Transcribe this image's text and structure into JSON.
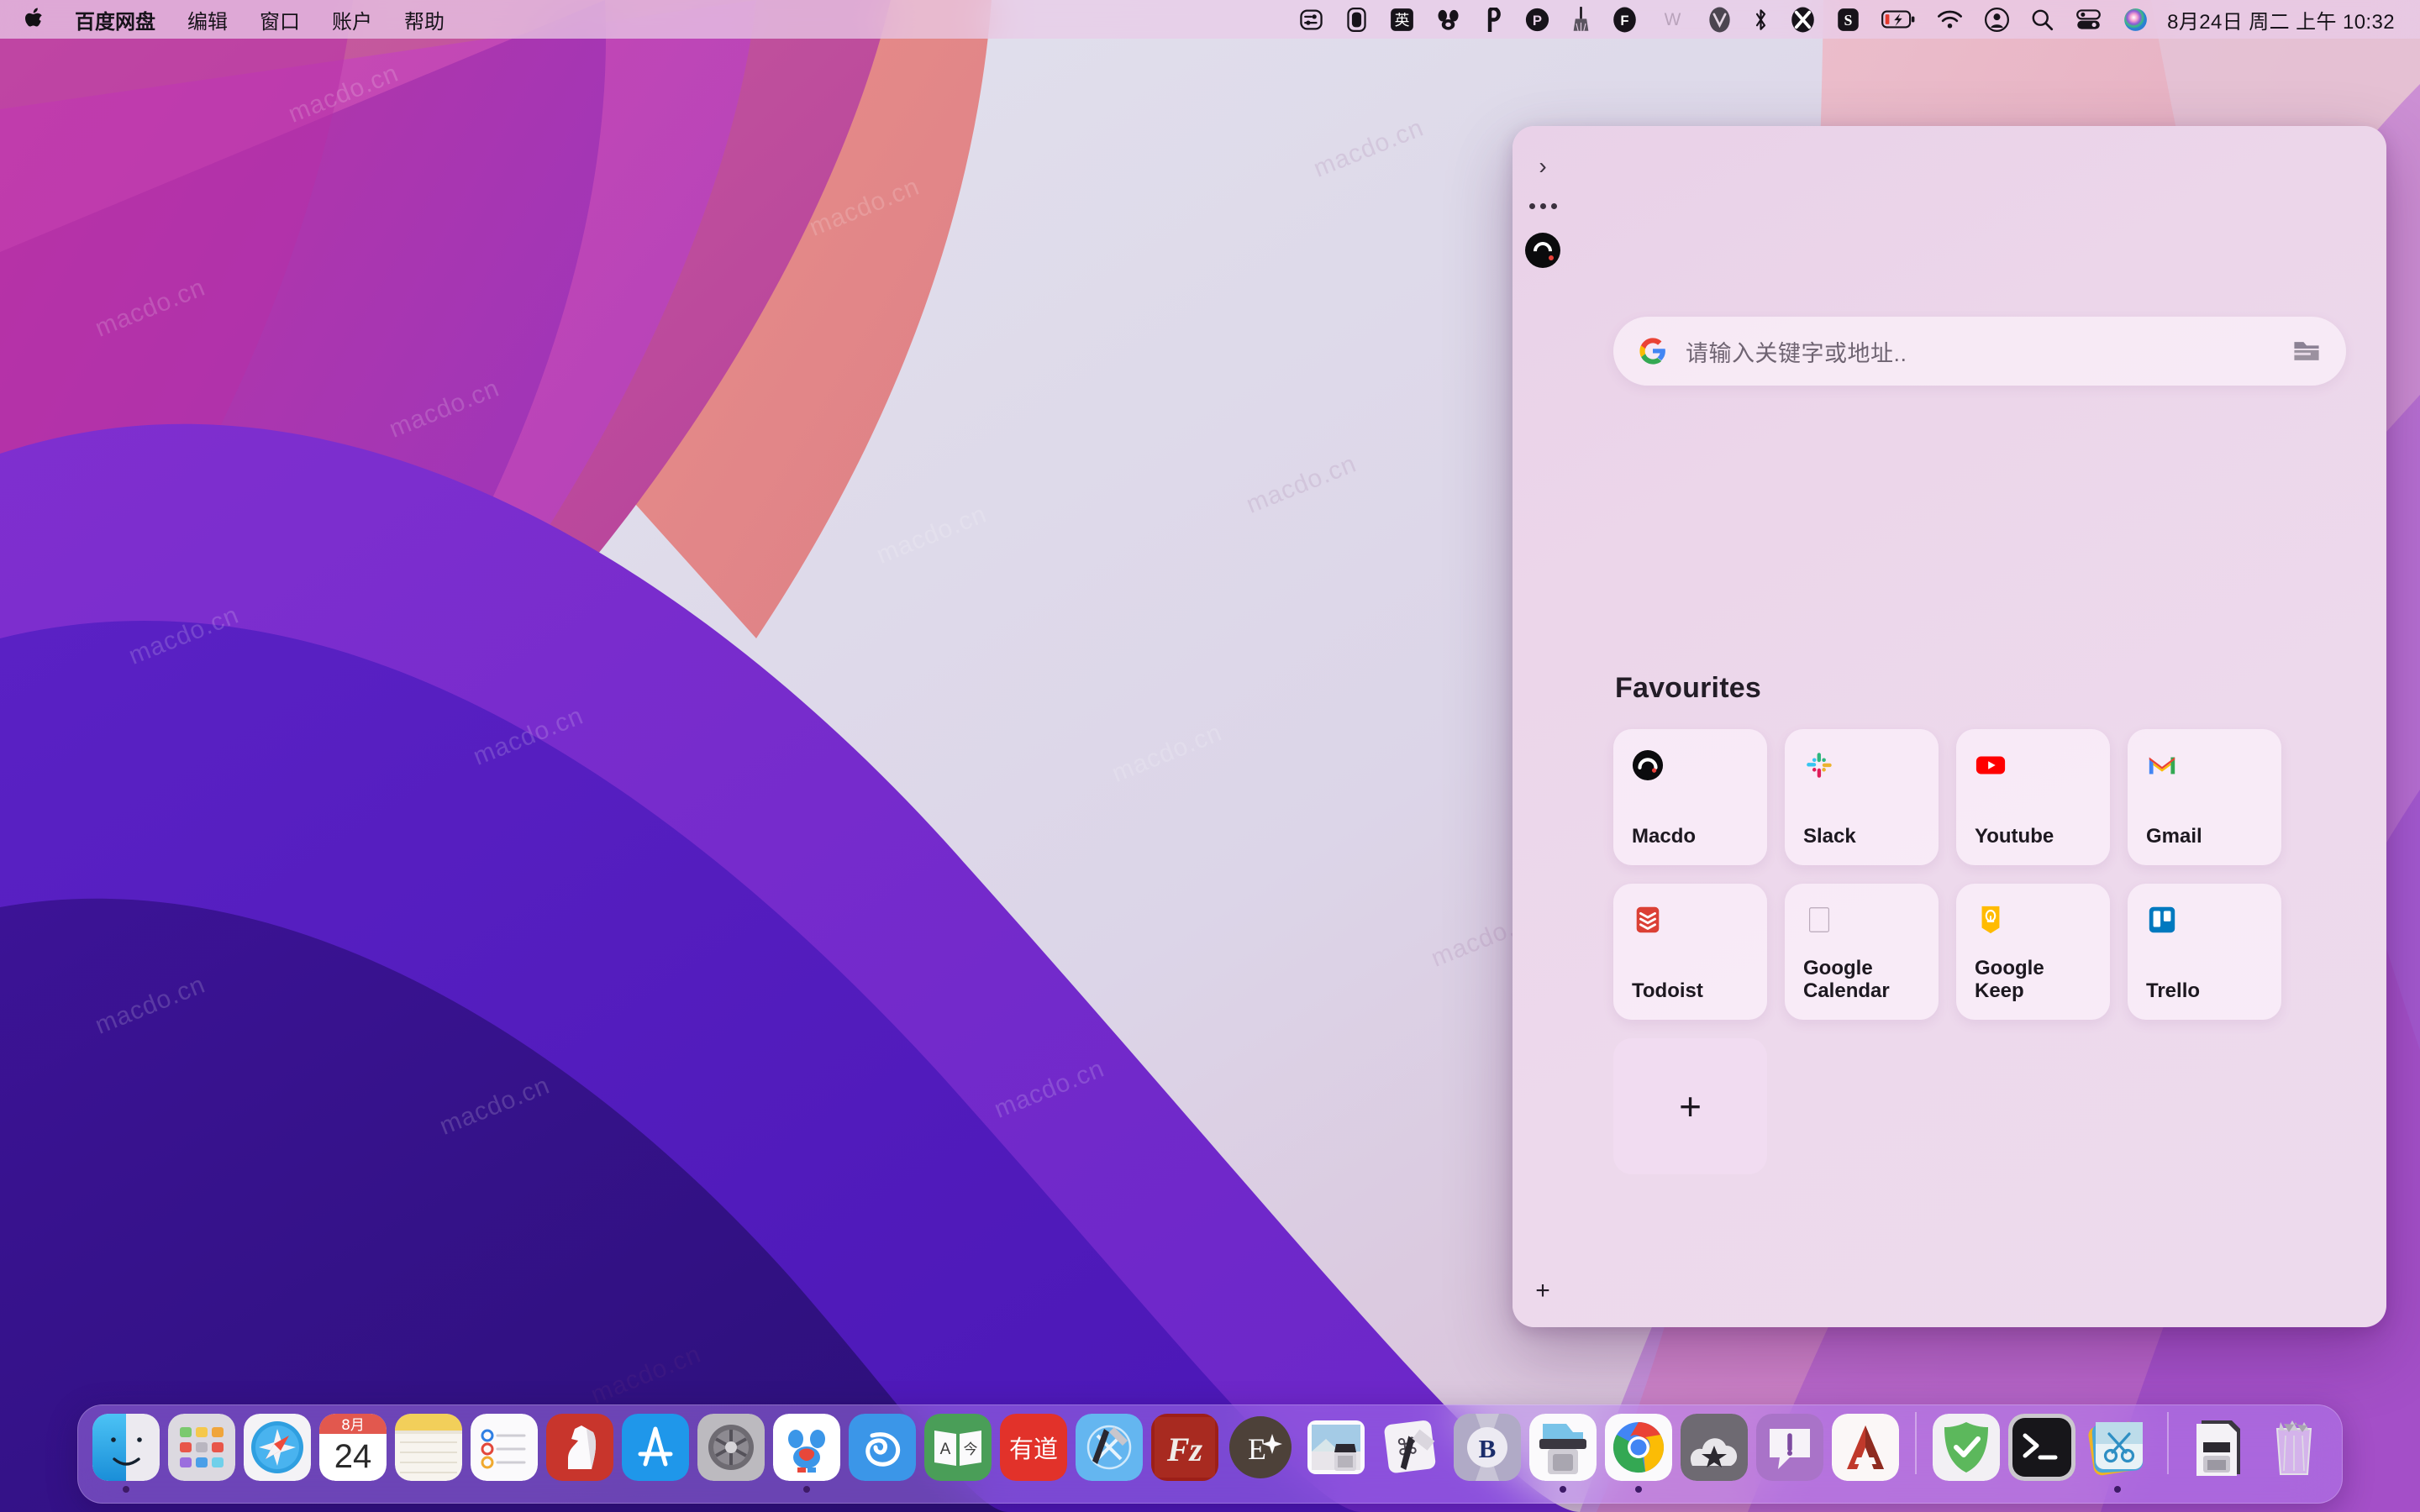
{
  "menubar": {
    "apple_icon": "apple-logo",
    "items": [
      {
        "label": "百度网盘",
        "bold": true
      },
      {
        "label": "编辑",
        "bold": false
      },
      {
        "label": "窗口",
        "bold": false
      },
      {
        "label": "账户",
        "bold": false
      },
      {
        "label": "帮助",
        "bold": false
      }
    ],
    "tray_icons": [
      "shortcuts-icon",
      "battery-widget-icon",
      "input-source-chinese-icon",
      "baidu-netdisk-icon",
      "paste-icon",
      "paypal-p-icon",
      "cleaner-broom-icon",
      "f-app-icon",
      "w-app-icon",
      "v-app-icon",
      "bluetooth-icon",
      "x-app-icon",
      "s-app-icon",
      "battery-charging-icon",
      "wifi-icon",
      "user-account-icon",
      "spotlight-search-icon",
      "control-center-icon",
      "siri-icon"
    ],
    "clock": "8月24日 周二 上午 10:32"
  },
  "panel": {
    "sidebar": {
      "chevron_icon": "chevron-right-icon",
      "more_icon": "more-dots-icon",
      "profile_icon": "macdo-logo-icon",
      "add_icon": "plus-icon"
    },
    "search": {
      "engine_icon": "google-g-icon",
      "placeholder": "请输入关键字或地址..",
      "bookmark_icon": "folder-icon"
    },
    "favourites": {
      "title": "Favourites",
      "tiles": [
        {
          "label": "Macdo",
          "icon": "macdo-icon"
        },
        {
          "label": "Slack",
          "icon": "slack-icon"
        },
        {
          "label": "Youtube",
          "icon": "youtube-icon"
        },
        {
          "label": "Gmail",
          "icon": "gmail-icon"
        },
        {
          "label": "Todoist",
          "icon": "todoist-icon"
        },
        {
          "label": "Google Calendar",
          "icon": "google-calendar-icon"
        },
        {
          "label": "Google Keep",
          "icon": "google-keep-icon"
        },
        {
          "label": "Trello",
          "icon": "trello-icon"
        }
      ],
      "add_label": "+"
    }
  },
  "dock": {
    "items": [
      {
        "name": "Finder",
        "icon": "finder-icon",
        "running": true
      },
      {
        "name": "Launchpad",
        "icon": "launchpad-icon",
        "running": false
      },
      {
        "name": "Safari",
        "icon": "safari-icon",
        "running": false
      },
      {
        "name": "Calendar",
        "icon": "calendar-icon",
        "running": false,
        "month": "8月",
        "day": "24"
      },
      {
        "name": "Notes",
        "icon": "notes-icon",
        "running": false
      },
      {
        "name": "Reminders",
        "icon": "reminders-icon",
        "running": false
      },
      {
        "name": "Chess",
        "icon": "chess-icon",
        "running": false
      },
      {
        "name": "App Store",
        "icon": "app-store-icon",
        "running": false
      },
      {
        "name": "System Preferences",
        "icon": "system-preferences-icon",
        "running": false
      },
      {
        "name": "Baidu Netdisk",
        "icon": "baidu-netdisk-icon",
        "running": true
      },
      {
        "name": "Cloud Music",
        "icon": "cloud-app-icon",
        "running": false
      },
      {
        "name": "Dictionary",
        "icon": "dictionary-icon",
        "running": false
      },
      {
        "name": "Youdao",
        "icon": "youdao-icon",
        "running": false
      },
      {
        "name": "Xcode",
        "icon": "xcode-icon",
        "running": false
      },
      {
        "name": "FileZilla",
        "icon": "filezilla-icon",
        "running": false
      },
      {
        "name": "ET",
        "icon": "et-app-icon",
        "running": false
      },
      {
        "name": "Preview",
        "icon": "preview-ink-icon",
        "running": false
      },
      {
        "name": "Keyboard Maestro",
        "icon": "keyboard-maestro-icon",
        "running": false
      },
      {
        "name": "Bartender",
        "icon": "bartender-b-icon",
        "running": false
      },
      {
        "name": "Scanner",
        "icon": "scanner-icon",
        "running": true
      },
      {
        "name": "Google Chrome",
        "icon": "chrome-icon",
        "running": true
      },
      {
        "name": "Cloud Star",
        "icon": "cloud-star-icon",
        "running": false
      },
      {
        "name": "Alert",
        "icon": "alert-bubble-icon",
        "running": false
      },
      {
        "name": "AutoCAD",
        "icon": "autocad-a-icon",
        "running": false
      },
      {
        "name": "separator-1",
        "icon": "dock-separator",
        "running": false
      },
      {
        "name": "AdGuard",
        "icon": "adguard-shield-icon",
        "running": false
      },
      {
        "name": "Terminal",
        "icon": "terminal-icon",
        "running": false
      },
      {
        "name": "Snipaste",
        "icon": "snipaste-scissors-icon",
        "running": true
      },
      {
        "name": "separator-2",
        "icon": "dock-separator",
        "running": false
      },
      {
        "name": "Downloads",
        "icon": "downloads-stack-icon",
        "running": false
      },
      {
        "name": "Trash",
        "icon": "trash-icon",
        "running": false
      }
    ]
  },
  "watermark": {
    "text": "macdo.cn"
  }
}
